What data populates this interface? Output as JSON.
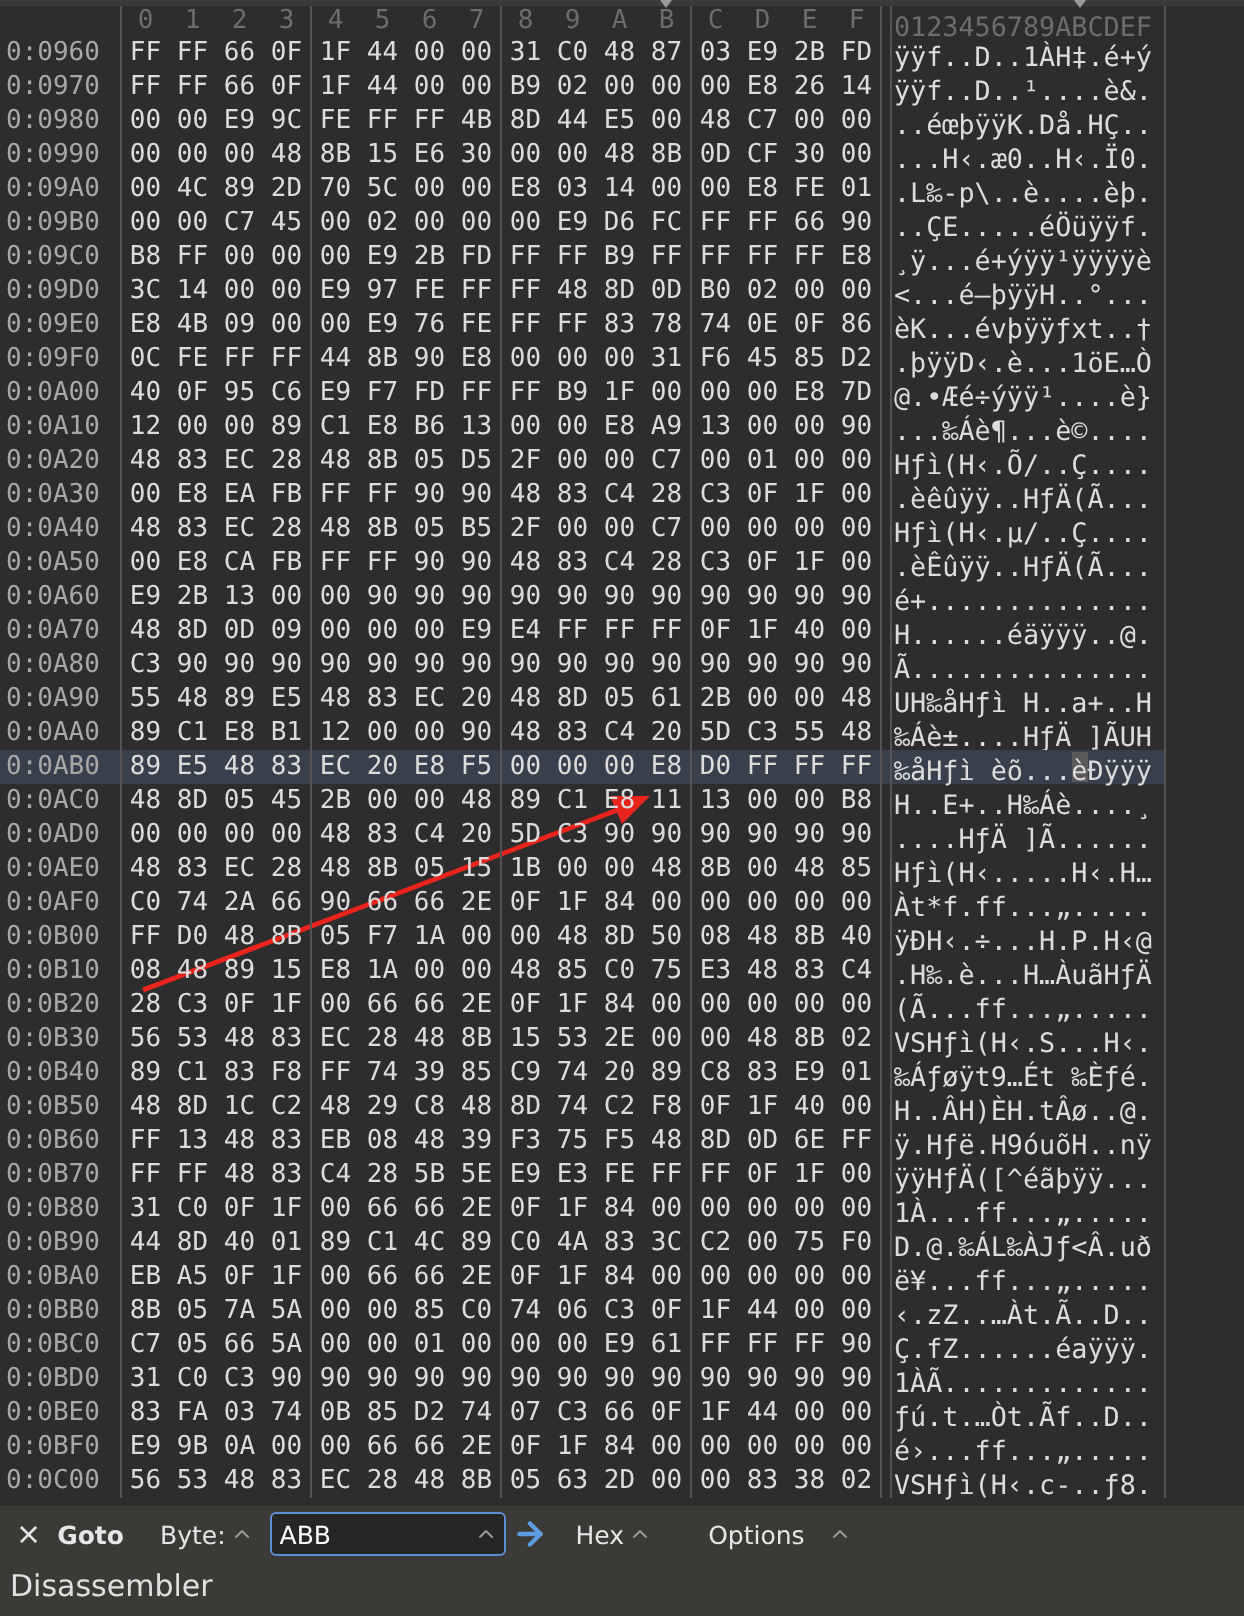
{
  "columns": [
    {
      "label": "0",
      "selected": false
    },
    {
      "label": "1",
      "selected": false
    },
    {
      "label": "2",
      "selected": false
    },
    {
      "label": "3",
      "selected": false
    },
    {
      "label": "4",
      "selected": false
    },
    {
      "label": "5",
      "selected": false
    },
    {
      "label": "6",
      "selected": false
    },
    {
      "label": "7",
      "selected": false
    },
    {
      "label": "8",
      "selected": false
    },
    {
      "label": "9",
      "selected": false
    },
    {
      "label": "A",
      "selected": false
    },
    {
      "label": "B",
      "selected": true
    },
    {
      "label": "C",
      "selected": false
    },
    {
      "label": "D",
      "selected": false
    },
    {
      "label": "E",
      "selected": false
    },
    {
      "label": "F",
      "selected": false
    }
  ],
  "ascii_header": "0123456789ABCDEF",
  "rows": [
    {
      "offset": "0:0960",
      "bytes": [
        "FF",
        "FF",
        "66",
        "0F",
        "1F",
        "44",
        "00",
        "00",
        "31",
        "C0",
        "48",
        "87",
        "03",
        "E9",
        "2B",
        "FD"
      ],
      "ascii": "ÿÿf..D..1ÀH‡.é+ý",
      "selected": false
    },
    {
      "offset": "0:0970",
      "bytes": [
        "FF",
        "FF",
        "66",
        "0F",
        "1F",
        "44",
        "00",
        "00",
        "B9",
        "02",
        "00",
        "00",
        "00",
        "E8",
        "26",
        "14"
      ],
      "ascii": "ÿÿf..D..¹....è&.",
      "selected": false
    },
    {
      "offset": "0:0980",
      "bytes": [
        "00",
        "00",
        "E9",
        "9C",
        "FE",
        "FF",
        "FF",
        "4B",
        "8D",
        "44",
        "E5",
        "00",
        "48",
        "C7",
        "00",
        "00"
      ],
      "ascii": "..éœþÿÿK.Då.HÇ..",
      "selected": false
    },
    {
      "offset": "0:0990",
      "bytes": [
        "00",
        "00",
        "00",
        "48",
        "8B",
        "15",
        "E6",
        "30",
        "00",
        "00",
        "48",
        "8B",
        "0D",
        "CF",
        "30",
        "00"
      ],
      "ascii": "...H‹.æ0..H‹.Ï0.",
      "selected": false
    },
    {
      "offset": "0:09A0",
      "bytes": [
        "00",
        "4C",
        "89",
        "2D",
        "70",
        "5C",
        "00",
        "00",
        "E8",
        "03",
        "14",
        "00",
        "00",
        "E8",
        "FE",
        "01"
      ],
      "ascii": ".L‰-p\\..è....èþ.",
      "selected": false
    },
    {
      "offset": "0:09B0",
      "bytes": [
        "00",
        "00",
        "C7",
        "45",
        "00",
        "02",
        "00",
        "00",
        "00",
        "E9",
        "D6",
        "FC",
        "FF",
        "FF",
        "66",
        "90"
      ],
      "ascii": "..ÇE.....éÖüÿÿf.",
      "selected": false
    },
    {
      "offset": "0:09C0",
      "bytes": [
        "B8",
        "FF",
        "00",
        "00",
        "00",
        "E9",
        "2B",
        "FD",
        "FF",
        "FF",
        "B9",
        "FF",
        "FF",
        "FF",
        "FF",
        "E8"
      ],
      "ascii": "¸ÿ...é+ýÿÿ¹ÿÿÿÿè",
      "selected": false
    },
    {
      "offset": "0:09D0",
      "bytes": [
        "3C",
        "14",
        "00",
        "00",
        "E9",
        "97",
        "FE",
        "FF",
        "FF",
        "48",
        "8D",
        "0D",
        "B0",
        "02",
        "00",
        "00"
      ],
      "ascii": "<...é—þÿÿH..°...",
      "selected": false
    },
    {
      "offset": "0:09E0",
      "bytes": [
        "E8",
        "4B",
        "09",
        "00",
        "00",
        "E9",
        "76",
        "FE",
        "FF",
        "FF",
        "83",
        "78",
        "74",
        "0E",
        "0F",
        "86"
      ],
      "ascii": "èK...évþÿÿƒxt..†",
      "selected": false
    },
    {
      "offset": "0:09F0",
      "bytes": [
        "0C",
        "FE",
        "FF",
        "FF",
        "44",
        "8B",
        "90",
        "E8",
        "00",
        "00",
        "00",
        "31",
        "F6",
        "45",
        "85",
        "D2"
      ],
      "ascii": ".þÿÿD‹.è...1öE…Ò",
      "selected": false
    },
    {
      "offset": "0:0A00",
      "bytes": [
        "40",
        "0F",
        "95",
        "C6",
        "E9",
        "F7",
        "FD",
        "FF",
        "FF",
        "B9",
        "1F",
        "00",
        "00",
        "00",
        "E8",
        "7D"
      ],
      "ascii": "@.•Æé÷ýÿÿ¹....è}",
      "selected": false
    },
    {
      "offset": "0:0A10",
      "bytes": [
        "12",
        "00",
        "00",
        "89",
        "C1",
        "E8",
        "B6",
        "13",
        "00",
        "00",
        "E8",
        "A9",
        "13",
        "00",
        "00",
        "90"
      ],
      "ascii": "...‰Áè¶...è©....",
      "selected": false
    },
    {
      "offset": "0:0A20",
      "bytes": [
        "48",
        "83",
        "EC",
        "28",
        "48",
        "8B",
        "05",
        "D5",
        "2F",
        "00",
        "00",
        "C7",
        "00",
        "01",
        "00",
        "00"
      ],
      "ascii": "Hƒì(H‹.Õ/..Ç....",
      "selected": false
    },
    {
      "offset": "0:0A30",
      "bytes": [
        "00",
        "E8",
        "EA",
        "FB",
        "FF",
        "FF",
        "90",
        "90",
        "48",
        "83",
        "C4",
        "28",
        "C3",
        "0F",
        "1F",
        "00"
      ],
      "ascii": ".èêûÿÿ..HƒÄ(Ã...",
      "selected": false
    },
    {
      "offset": "0:0A40",
      "bytes": [
        "48",
        "83",
        "EC",
        "28",
        "48",
        "8B",
        "05",
        "B5",
        "2F",
        "00",
        "00",
        "C7",
        "00",
        "00",
        "00",
        "00"
      ],
      "ascii": "Hƒì(H‹.µ/..Ç....",
      "selected": false
    },
    {
      "offset": "0:0A50",
      "bytes": [
        "00",
        "E8",
        "CA",
        "FB",
        "FF",
        "FF",
        "90",
        "90",
        "48",
        "83",
        "C4",
        "28",
        "C3",
        "0F",
        "1F",
        "00"
      ],
      "ascii": ".èÊûÿÿ..HƒÄ(Ã...",
      "selected": false
    },
    {
      "offset": "0:0A60",
      "bytes": [
        "E9",
        "2B",
        "13",
        "00",
        "00",
        "90",
        "90",
        "90",
        "90",
        "90",
        "90",
        "90",
        "90",
        "90",
        "90",
        "90"
      ],
      "ascii": "é+..............",
      "selected": false
    },
    {
      "offset": "0:0A70",
      "bytes": [
        "48",
        "8D",
        "0D",
        "09",
        "00",
        "00",
        "00",
        "E9",
        "E4",
        "FF",
        "FF",
        "FF",
        "0F",
        "1F",
        "40",
        "00"
      ],
      "ascii": "H......éäÿÿÿ..@.",
      "selected": false
    },
    {
      "offset": "0:0A80",
      "bytes": [
        "C3",
        "90",
        "90",
        "90",
        "90",
        "90",
        "90",
        "90",
        "90",
        "90",
        "90",
        "90",
        "90",
        "90",
        "90",
        "90"
      ],
      "ascii": "Ã...............",
      "selected": false
    },
    {
      "offset": "0:0A90",
      "bytes": [
        "55",
        "48",
        "89",
        "E5",
        "48",
        "83",
        "EC",
        "20",
        "48",
        "8D",
        "05",
        "61",
        "2B",
        "00",
        "00",
        "48"
      ],
      "ascii": "UH‰åHƒì H..a+..H",
      "selected": false
    },
    {
      "offset": "0:0AA0",
      "bytes": [
        "89",
        "C1",
        "E8",
        "B1",
        "12",
        "00",
        "00",
        "90",
        "48",
        "83",
        "C4",
        "20",
        "5D",
        "C3",
        "55",
        "48"
      ],
      "ascii": "‰Áè±....HƒÄ ]ÃUH",
      "selected": false
    },
    {
      "offset": "0:0AB0",
      "bytes": [
        "89",
        "E5",
        "48",
        "83",
        "EC",
        "20",
        "E8",
        "F5",
        "00",
        "00",
        "00",
        "E8",
        "D0",
        "FF",
        "FF",
        "FF"
      ],
      "ascii": "‰åHƒì èõ...èÐÿÿÿ",
      "selected": true
    },
    {
      "offset": "0:0AC0",
      "bytes": [
        "48",
        "8D",
        "05",
        "45",
        "2B",
        "00",
        "00",
        "48",
        "89",
        "C1",
        "E8",
        "11",
        "13",
        "00",
        "00",
        "B8"
      ],
      "ascii": "H..E+..H‰Áè....¸",
      "selected": false
    },
    {
      "offset": "0:0AD0",
      "bytes": [
        "00",
        "00",
        "00",
        "00",
        "48",
        "83",
        "C4",
        "20",
        "5D",
        "C3",
        "90",
        "90",
        "90",
        "90",
        "90",
        "90"
      ],
      "ascii": "....HƒÄ ]Ã......",
      "selected": false
    },
    {
      "offset": "0:0AE0",
      "bytes": [
        "48",
        "83",
        "EC",
        "28",
        "48",
        "8B",
        "05",
        "15",
        "1B",
        "00",
        "00",
        "48",
        "8B",
        "00",
        "48",
        "85"
      ],
      "ascii": "Hƒì(H‹.....H‹.H…",
      "selected": false
    },
    {
      "offset": "0:0AF0",
      "bytes": [
        "C0",
        "74",
        "2A",
        "66",
        "90",
        "66",
        "66",
        "2E",
        "0F",
        "1F",
        "84",
        "00",
        "00",
        "00",
        "00",
        "00"
      ],
      "ascii": "Àt*f.ff...„.....",
      "selected": false
    },
    {
      "offset": "0:0B00",
      "bytes": [
        "FF",
        "D0",
        "48",
        "8B",
        "05",
        "F7",
        "1A",
        "00",
        "00",
        "48",
        "8D",
        "50",
        "08",
        "48",
        "8B",
        "40"
      ],
      "ascii": "ÿÐH‹.÷...H.P.H‹@",
      "selected": false
    },
    {
      "offset": "0:0B10",
      "bytes": [
        "08",
        "48",
        "89",
        "15",
        "E8",
        "1A",
        "00",
        "00",
        "48",
        "85",
        "C0",
        "75",
        "E3",
        "48",
        "83",
        "C4"
      ],
      "ascii": ".H‰.è...H…ÀuãHƒÄ",
      "selected": false
    },
    {
      "offset": "0:0B20",
      "bytes": [
        "28",
        "C3",
        "0F",
        "1F",
        "00",
        "66",
        "66",
        "2E",
        "0F",
        "1F",
        "84",
        "00",
        "00",
        "00",
        "00",
        "00"
      ],
      "ascii": "(Ã...ff...„.....",
      "selected": false
    },
    {
      "offset": "0:0B30",
      "bytes": [
        "56",
        "53",
        "48",
        "83",
        "EC",
        "28",
        "48",
        "8B",
        "15",
        "53",
        "2E",
        "00",
        "00",
        "48",
        "8B",
        "02"
      ],
      "ascii": "VSHƒì(H‹.S...H‹.",
      "selected": false
    },
    {
      "offset": "0:0B40",
      "bytes": [
        "89",
        "C1",
        "83",
        "F8",
        "FF",
        "74",
        "39",
        "85",
        "C9",
        "74",
        "20",
        "89",
        "C8",
        "83",
        "E9",
        "01"
      ],
      "ascii": "‰Áƒøÿt9…Ét ‰Èƒé.",
      "selected": false
    },
    {
      "offset": "0:0B50",
      "bytes": [
        "48",
        "8D",
        "1C",
        "C2",
        "48",
        "29",
        "C8",
        "48",
        "8D",
        "74",
        "C2",
        "F8",
        "0F",
        "1F",
        "40",
        "00"
      ],
      "ascii": "H..ÂH)ÈH.tÂø..@.",
      "selected": false
    },
    {
      "offset": "0:0B60",
      "bytes": [
        "FF",
        "13",
        "48",
        "83",
        "EB",
        "08",
        "48",
        "39",
        "F3",
        "75",
        "F5",
        "48",
        "8D",
        "0D",
        "6E",
        "FF"
      ],
      "ascii": "ÿ.Hƒë.H9óuõH..nÿ",
      "selected": false
    },
    {
      "offset": "0:0B70",
      "bytes": [
        "FF",
        "FF",
        "48",
        "83",
        "C4",
        "28",
        "5B",
        "5E",
        "E9",
        "E3",
        "FE",
        "FF",
        "FF",
        "0F",
        "1F",
        "00"
      ],
      "ascii": "ÿÿHƒÄ([^éãþÿÿ...",
      "selected": false
    },
    {
      "offset": "0:0B80",
      "bytes": [
        "31",
        "C0",
        "0F",
        "1F",
        "00",
        "66",
        "66",
        "2E",
        "0F",
        "1F",
        "84",
        "00",
        "00",
        "00",
        "00",
        "00"
      ],
      "ascii": "1À...ff...„.....",
      "selected": false
    },
    {
      "offset": "0:0B90",
      "bytes": [
        "44",
        "8D",
        "40",
        "01",
        "89",
        "C1",
        "4C",
        "89",
        "C0",
        "4A",
        "83",
        "3C",
        "C2",
        "00",
        "75",
        "F0"
      ],
      "ascii": "D.@.‰ÁL‰ÀJƒ<Â.uð",
      "selected": false
    },
    {
      "offset": "0:0BA0",
      "bytes": [
        "EB",
        "A5",
        "0F",
        "1F",
        "00",
        "66",
        "66",
        "2E",
        "0F",
        "1F",
        "84",
        "00",
        "00",
        "00",
        "00",
        "00"
      ],
      "ascii": "ë¥...ff...„.....",
      "selected": false
    },
    {
      "offset": "0:0BB0",
      "bytes": [
        "8B",
        "05",
        "7A",
        "5A",
        "00",
        "00",
        "85",
        "C0",
        "74",
        "06",
        "C3",
        "0F",
        "1F",
        "44",
        "00",
        "00"
      ],
      "ascii": "‹.zZ..…Àt.Ã..D..",
      "selected": false
    },
    {
      "offset": "0:0BC0",
      "bytes": [
        "C7",
        "05",
        "66",
        "5A",
        "00",
        "00",
        "01",
        "00",
        "00",
        "00",
        "E9",
        "61",
        "FF",
        "FF",
        "FF",
        "90"
      ],
      "ascii": "Ç.fZ......éaÿÿÿ.",
      "selected": false
    },
    {
      "offset": "0:0BD0",
      "bytes": [
        "31",
        "C0",
        "C3",
        "90",
        "90",
        "90",
        "90",
        "90",
        "90",
        "90",
        "90",
        "90",
        "90",
        "90",
        "90",
        "90"
      ],
      "ascii": "1ÀÃ.............",
      "selected": false
    },
    {
      "offset": "0:0BE0",
      "bytes": [
        "83",
        "FA",
        "03",
        "74",
        "0B",
        "85",
        "D2",
        "74",
        "07",
        "C3",
        "66",
        "0F",
        "1F",
        "44",
        "00",
        "00"
      ],
      "ascii": "ƒú.t.…Òt.Ãf..D..",
      "selected": false
    },
    {
      "offset": "0:0BF0",
      "bytes": [
        "E9",
        "9B",
        "0A",
        "00",
        "00",
        "66",
        "66",
        "2E",
        "0F",
        "1F",
        "84",
        "00",
        "00",
        "00",
        "00",
        "00"
      ],
      "ascii": "é›...ff...„.....",
      "selected": false
    },
    {
      "offset": "0:0C00",
      "bytes": [
        "56",
        "53",
        "48",
        "83",
        "EC",
        "28",
        "48",
        "8B",
        "05",
        "63",
        "2D",
        "00",
        "00",
        "83",
        "38",
        "02"
      ],
      "ascii": "VSHƒì(H‹.c-..ƒ8.",
      "selected": false
    }
  ],
  "goto_bar": {
    "close": "×",
    "title": "Goto",
    "byte_label": "Byte:",
    "input_value": "ABB",
    "format": "Hex",
    "options": "Options"
  },
  "panel_title": "Disassembler"
}
